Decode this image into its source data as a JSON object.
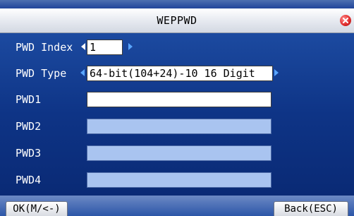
{
  "window": {
    "title": "WEPPWD"
  },
  "form": {
    "pwd_index": {
      "label": "PWD Index",
      "value": "1"
    },
    "pwd_type": {
      "label": "PWD Type",
      "value": "64-bit(104+24)-10 16 Digit"
    },
    "pwd1": {
      "label": "PWD1",
      "value": ""
    },
    "pwd2": {
      "label": "PWD2",
      "value": ""
    },
    "pwd3": {
      "label": "PWD3",
      "value": ""
    },
    "pwd4": {
      "label": "PWD4",
      "value": ""
    }
  },
  "footer": {
    "ok_label": "OK(M/<-)",
    "back_label": "Back(ESC)"
  },
  "icons": {
    "close": "close-icon",
    "prev": "arrow-left-icon",
    "next": "arrow-right-icon"
  },
  "colors": {
    "background": "#0e3486",
    "titlebar": "#e9ecf2",
    "active_field": "#ffffff",
    "inactive_field": "#a9c4f0",
    "close_button": "#e23030"
  }
}
